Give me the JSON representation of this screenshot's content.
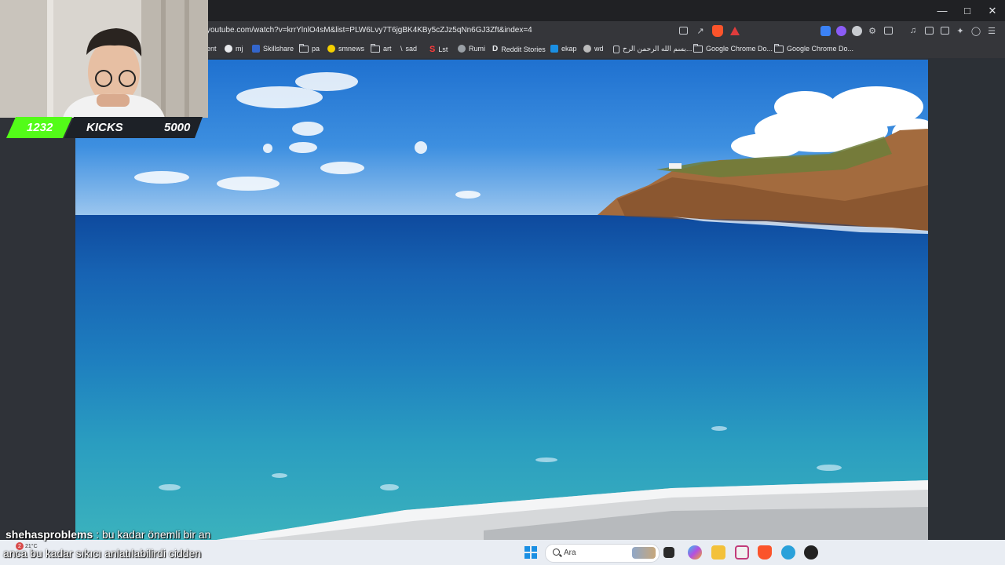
{
  "browser": {
    "url": "youtube.com/watch?v=krrYlnlO4sM&list=PLW6Lvy7T6jgBK4KBy5cZJz5qNn6GJ3Zft&index=4",
    "bookmarks": [
      {
        "label": "ent",
        "icon": "none"
      },
      {
        "label": "mj",
        "icon": "github-icon"
      },
      {
        "label": "Skillshare",
        "icon": "skillshare-icon"
      },
      {
        "label": "pa",
        "icon": "folder-icon"
      },
      {
        "label": "smnews",
        "icon": "smiley-icon"
      },
      {
        "label": "art",
        "icon": "folder-icon"
      },
      {
        "label": "sad",
        "icon": "slash-icon"
      },
      {
        "label": "Lst",
        "icon": "s-logo-icon"
      },
      {
        "label": "Rumi",
        "icon": "rumi-icon"
      },
      {
        "label": "Reddit Stories",
        "icon": "page-icon"
      },
      {
        "label": "ekap",
        "icon": "ekap-icon"
      },
      {
        "label": "wd",
        "icon": "wd-icon"
      },
      {
        "label": "بسم الله الرحمن الرح...",
        "icon": "doc-icon"
      },
      {
        "label": "Google Chrome Do...",
        "icon": "folder-icon"
      },
      {
        "label": "Google Chrome Do...",
        "icon": "folder-icon"
      }
    ]
  },
  "overlay": {
    "kicks_count": "1232",
    "kicks_label": "KICKS",
    "kicks_goal": "5000",
    "chat": {
      "username": "shehasproblems",
      "separator": " : ",
      "message_line1": "bu kadar önemli bir an",
      "message_line2": "anca bu kadar sıkıcı anlatılabilirdi cidden"
    }
  },
  "taskbar": {
    "search_placeholder": "Ara",
    "weather_badge": "2",
    "weather_temp": "21°C"
  },
  "colors": {
    "browser_dark": "#202124",
    "toolbar": "#35363a",
    "kicks_green": "#53fc18",
    "taskbar": "#e9edf3"
  }
}
